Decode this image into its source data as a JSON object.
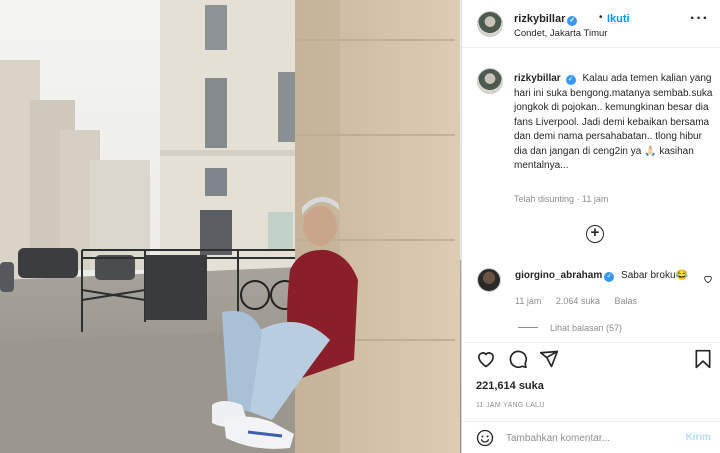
{
  "post": {
    "username": "rizkybillar",
    "verified_icon": "verified-badge-icon",
    "separator": "•",
    "follow_label": "Ikuti",
    "location": "Condet, Jakarta Timur",
    "more_icon": "more-options-icon"
  },
  "caption": {
    "username": "rizkybillar",
    "text": "Kalau ada temen kalian yang hari ini suka bengong.matanya sembab.suka jongkok di pojokan.. kemungkinan besar dia fans Liverpool. Jadi demi kebaikan bersama dan demi nama persahabatan.. tlong hibur dia dan jangan di ceng2in ya 🙏🏻 kasihan mentalnya...",
    "edited_label": "Telah disunting",
    "edited_time": "11 jam"
  },
  "comment": {
    "username": "giorgino_abraham",
    "text": "Sabar broku😂",
    "time": "11 jam",
    "likes": "2.064 suka",
    "reply_label": "Balas",
    "view_replies": "Lihat balasan (57)"
  },
  "actions": {
    "like_icon": "heart-icon",
    "comment_icon": "comment-icon",
    "share_icon": "share-icon",
    "save_icon": "bookmark-icon"
  },
  "stats": {
    "likes": "221,614 suka",
    "time_ago": "11 JAM YANG LALU"
  },
  "add_comment": {
    "placeholder": "Tambahkan komentar...",
    "post_label": "Kirim"
  },
  "colors": {
    "accent": "#0095f6",
    "verified": "#3897f0",
    "post_disabled": "#b2dffc",
    "muted": "#8e8e8e"
  }
}
